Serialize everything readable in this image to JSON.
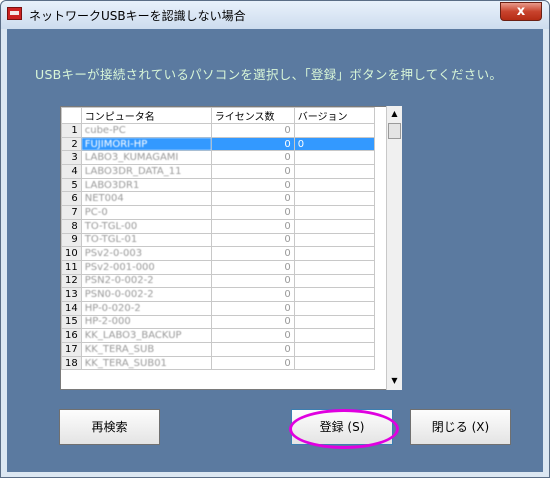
{
  "window": {
    "title": "ネットワークUSBキーを認識しない場合",
    "close_label": "x"
  },
  "instruction": "USBキーが接続されているパソコンを選択し、「登録」ボタンを押してください。",
  "grid": {
    "columns": [
      "コンピュータ名",
      "ライセンス数",
      "バージョン"
    ],
    "rows": [
      {
        "num": "1",
        "name": "cube-PC",
        "licenses": "0",
        "version": "",
        "selected": false
      },
      {
        "num": "2",
        "name": "FUJIMORI-HP",
        "licenses": "0",
        "version": "0",
        "selected": true
      },
      {
        "num": "3",
        "name": "LABO3_KUMAGAMI",
        "licenses": "0",
        "version": "",
        "selected": false
      },
      {
        "num": "4",
        "name": "LABO3DR_DATA_11",
        "licenses": "0",
        "version": "",
        "selected": false
      },
      {
        "num": "5",
        "name": "LABO3DR1",
        "licenses": "0",
        "version": "",
        "selected": false
      },
      {
        "num": "6",
        "name": "NET004",
        "licenses": "0",
        "version": "",
        "selected": false
      },
      {
        "num": "7",
        "name": "PC-0",
        "licenses": "0",
        "version": "",
        "selected": false
      },
      {
        "num": "8",
        "name": "TO-TGL-00",
        "licenses": "0",
        "version": "",
        "selected": false
      },
      {
        "num": "9",
        "name": "TO-TGL-01",
        "licenses": "0",
        "version": "",
        "selected": false
      },
      {
        "num": "10",
        "name": "PSv2-0-003",
        "licenses": "0",
        "version": "",
        "selected": false
      },
      {
        "num": "11",
        "name": "PSv2-001-000",
        "licenses": "0",
        "version": "",
        "selected": false
      },
      {
        "num": "12",
        "name": "PSN2-0-002-2",
        "licenses": "0",
        "version": "",
        "selected": false
      },
      {
        "num": "13",
        "name": "PSN0-0-002-2",
        "licenses": "0",
        "version": "",
        "selected": false
      },
      {
        "num": "14",
        "name": "HP-0-020-2",
        "licenses": "0",
        "version": "",
        "selected": false
      },
      {
        "num": "15",
        "name": "HP-2-000",
        "licenses": "0",
        "version": "",
        "selected": false
      },
      {
        "num": "16",
        "name": "KK_LABO3_BACKUP",
        "licenses": "0",
        "version": "",
        "selected": false
      },
      {
        "num": "17",
        "name": "KK_TERA_SUB",
        "licenses": "0",
        "version": "",
        "selected": false
      },
      {
        "num": "18",
        "name": "KK_TERA_SUB01",
        "licenses": "0",
        "version": "",
        "selected": false
      }
    ]
  },
  "scrollbar": {
    "up": "▲",
    "down": "▼"
  },
  "buttons": {
    "search": "再検索",
    "register": "登録 (S)",
    "close": "閉じる (X)"
  }
}
